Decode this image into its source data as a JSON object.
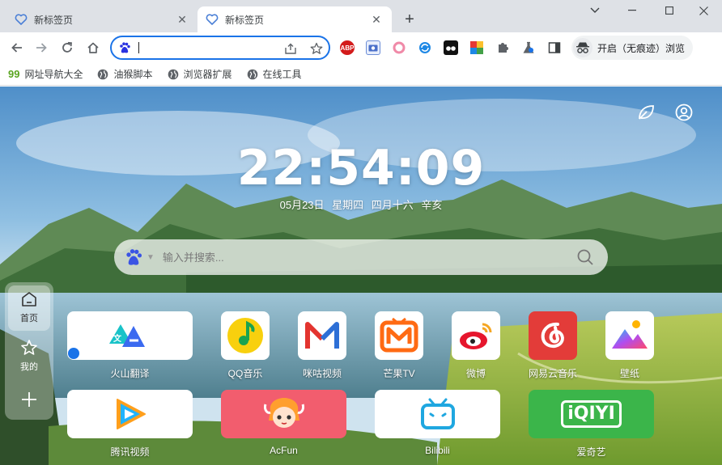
{
  "tabs": [
    {
      "title": "新标签页",
      "active": false
    },
    {
      "title": "新标签页",
      "active": true
    }
  ],
  "new_tab_label": "+",
  "toolbar": {
    "omnibox_value": "",
    "incognito_label": "开启（无痕迹）浏览",
    "ext_abp_label": "ABP"
  },
  "bookmarks": [
    {
      "prefix": "99",
      "label": "网址导航大全",
      "icon": "99-icon"
    },
    {
      "label": "油猴脚本",
      "icon": "globe-icon"
    },
    {
      "label": "浏览器扩展",
      "icon": "globe-icon"
    },
    {
      "label": "在线工具",
      "icon": "globe-icon"
    }
  ],
  "page": {
    "clock": "22:54:09",
    "date": "05月23日 星期四 四月十六 辛亥",
    "search_placeholder": "输入并搜索...",
    "sidebar": [
      {
        "label": "首页",
        "icon": "home-icon",
        "active": true
      },
      {
        "label": "我的",
        "icon": "star-icon",
        "active": false
      },
      {
        "label": "",
        "icon": "plus-icon",
        "active": false
      }
    ],
    "shortcuts": [
      {
        "label": "火山翻译",
        "icon": "volcano-translate-icon"
      },
      {
        "label": "QQ音乐",
        "icon": "qq-music-icon"
      },
      {
        "label": "咪咕视频",
        "icon": "migu-video-icon"
      },
      {
        "label": "芒果TV",
        "icon": "mango-tv-icon"
      },
      {
        "label": "微博",
        "icon": "weibo-icon"
      },
      {
        "label": "网易云音乐",
        "icon": "netease-music-icon"
      },
      {
        "label": "壁纸",
        "icon": "wallpaper-icon"
      },
      {
        "label": "腾讯视频",
        "icon": "tencent-video-icon"
      },
      {
        "label": "AcFun",
        "icon": "acfun-icon"
      },
      {
        "label": "Bilibili",
        "icon": "bilibili-icon"
      },
      {
        "label": "爱奇艺",
        "icon": "iqiyi-icon"
      }
    ],
    "iqiyi_logo_text": "iQIYI"
  },
  "colors": {
    "accent": "#1a73e8",
    "acfun": "#f25d6e",
    "iqiyi": "#3bb54a",
    "netease": "#e33c39"
  }
}
